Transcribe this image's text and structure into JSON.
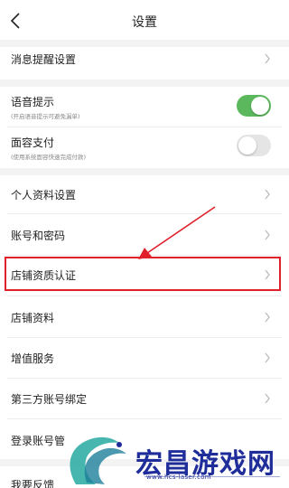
{
  "header": {
    "title": "设置"
  },
  "rows": {
    "message_reminder": "消息提醒设置",
    "voice": {
      "label": "语音提示",
      "sub": "(开启语音提示可避免漏单)",
      "on": true
    },
    "face_pay": {
      "label": "面容支付",
      "sub": "(使用系统面容快速完成付款)",
      "on": false
    },
    "profile": "个人资料设置",
    "account_password": "账号和密码",
    "store_certification": "店铺资质认证",
    "store_info": "店铺资料",
    "value_added": "增值服务",
    "third_party": "第三方账号绑定",
    "login_manage": "登录账号管",
    "feedback": "我要反馈"
  },
  "colors": {
    "toggle_on": "#5cb85c",
    "toggle_off": "#e5e5e5",
    "annotation_red": "#e0202a",
    "watermark_blue": "#1e2d9a"
  },
  "watermark": {
    "text": "宏昌游戏网",
    "url": "www.hcs-laser.com"
  }
}
